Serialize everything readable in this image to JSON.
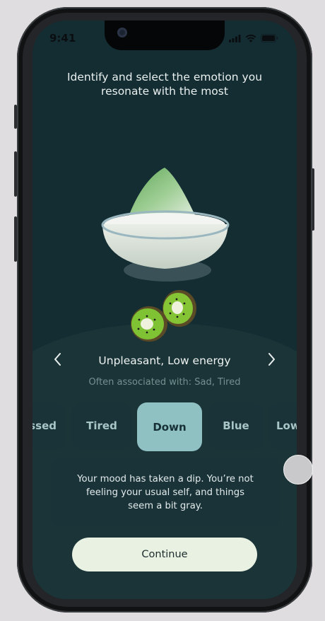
{
  "status_bar": {
    "time": "9:41"
  },
  "prompt": {
    "line1": "Identify and select the emotion you",
    "line2": "resonate with the most"
  },
  "emotion": {
    "title": "Unpleasant, Low energy",
    "associated": "Often associated with: Sad, Tired"
  },
  "chips": [
    {
      "label": "essed",
      "selected": false
    },
    {
      "label": "Tired",
      "selected": false
    },
    {
      "label": "Down",
      "selected": true
    },
    {
      "label": "Blue",
      "selected": false
    },
    {
      "label": "Low",
      "selected": false
    }
  ],
  "description": {
    "line1": "Your mood has taken a dip. You’re not",
    "line2": "feeling your usual self, and things",
    "line3": "seem a bit gray."
  },
  "continue_label": "Continue",
  "colors": {
    "screen_bg": "#142d33",
    "chip_bg": "#1a3339",
    "chip_selected": "#8fc1c2",
    "button_bg": "#e8f1e2"
  },
  "icons": {
    "prev": "chevron-left-icon",
    "next": "chevron-right-icon"
  }
}
